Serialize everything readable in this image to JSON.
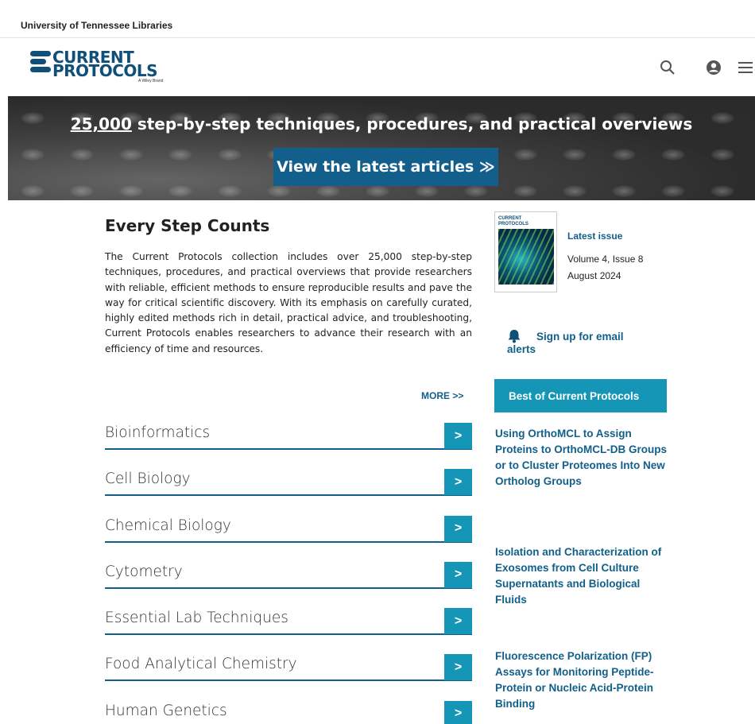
{
  "institution": "University of Tennessee Libraries",
  "logo": {
    "line1": "CURRENT",
    "line2": "PROTOCOLS",
    "tagline": "A Wiley Brand"
  },
  "header_icons": [
    "search-icon",
    "account-icon",
    "menu-icon"
  ],
  "banner": {
    "headline_number": "25,000",
    "headline_rest": " step-by-step techniques, procedures, and practical overviews",
    "cta_label": "View the latest articles",
    "cta_arrow": "≫"
  },
  "main": {
    "title": "Every Step Counts",
    "intro": "The Current Protocols collection includes over 25,000 step-by-step techniques, procedures, and practical overviews that provide researchers with reliable, efficient methods to ensure reproducible results and pave the way for critical scientific discovery. With its emphasis on carefully curated, highly edited methods rich in detail, practical advice, and troubleshooting, Current Protocols enables researchers to advance their research with an efficiency of time and resources.",
    "more_label": "MORE >>"
  },
  "categories": [
    {
      "label": "Bioinformatics",
      "go": ">"
    },
    {
      "label": "Cell Biology",
      "go": ">"
    },
    {
      "label": "Chemical Biology",
      "go": ">"
    },
    {
      "label": "Cytometry",
      "go": ">"
    },
    {
      "label": "Essential Lab Techniques",
      "go": ">"
    },
    {
      "label": "Food Analytical Chemistry",
      "go": ">"
    },
    {
      "label": "Human Genetics",
      "go": ">"
    }
  ],
  "sidebar": {
    "cover_title_1": "CURRENT",
    "cover_title_2": "PROTOCOLS",
    "latest_issue_label": "Latest issue",
    "volume": "Volume 4, Issue 8",
    "date": "August 2024",
    "alert_line1": "Sign up for email",
    "alert_line2": "alerts",
    "best_label": "Best of Current Protocols",
    "featured": [
      "Using OrthoMCL to Assign Proteins to OrthoMCL-DB Groups or to Cluster Proteomes Into New Ortholog Groups",
      "Isolation and Characterization of Exosomes from Cell Culture Supernatants and Biological Fluids",
      "Fluorescence Polarization (FP) Assays for Monitoring Peptide-Protein or Nucleic Acid-Protein Binding"
    ]
  },
  "colors": {
    "brand_navy": "#0f4f78",
    "cta_blue": "#115f8a",
    "teal": "#1596b6"
  }
}
